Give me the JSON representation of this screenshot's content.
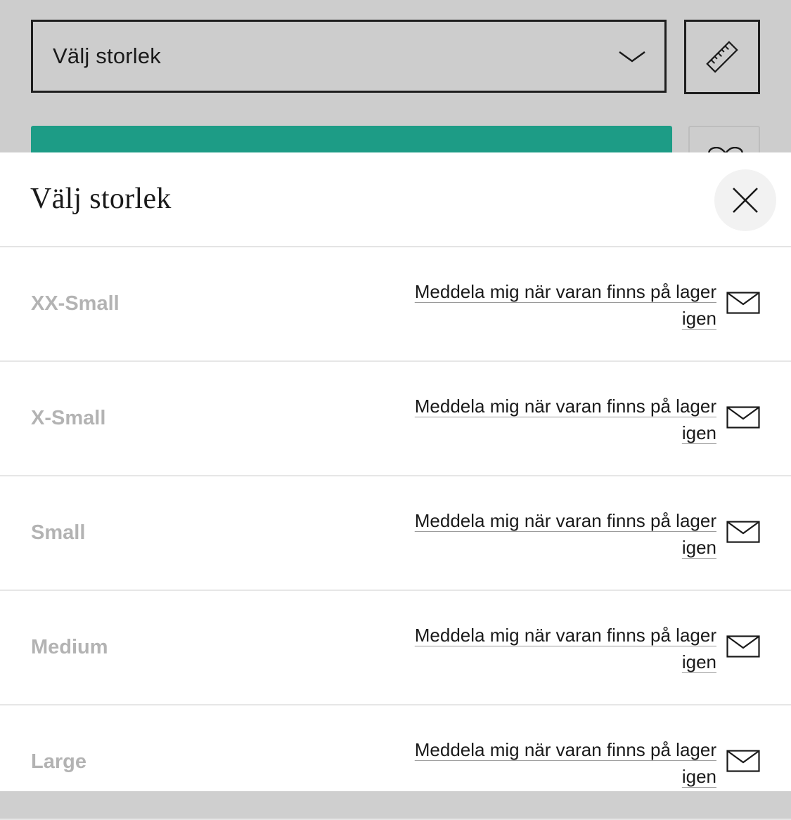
{
  "background_page": {
    "size_select": {
      "label": "Välj storlek",
      "icon": "chevron-down-icon"
    },
    "size_guide": {
      "icon": "ruler-icon"
    },
    "add_to_cart": {
      "color": "#1d9c86"
    },
    "wishlist": {
      "icon": "heart-icon"
    }
  },
  "sheet": {
    "title": "Välj storlek",
    "close_icon": "close-icon",
    "sizes": [
      {
        "name": "XX-Small",
        "notify_label": "Meddela mig när varan finns på lager igen",
        "icon": "mail-icon"
      },
      {
        "name": "X-Small",
        "notify_label": "Meddela mig när varan finns på lager igen",
        "icon": "mail-icon"
      },
      {
        "name": "Small",
        "notify_label": "Meddela mig när varan finns på lager igen",
        "icon": "mail-icon"
      },
      {
        "name": "Medium",
        "notify_label": "Meddela mig när varan finns på lager igen",
        "icon": "mail-icon"
      },
      {
        "name": "Large",
        "notify_label": "Meddela mig när varan finns på lager igen",
        "icon": "mail-icon"
      }
    ]
  },
  "colors": {
    "accent": "#1d9c86",
    "unavailable_text": "#b3b3b3",
    "overlay": "#cdcdcd"
  }
}
